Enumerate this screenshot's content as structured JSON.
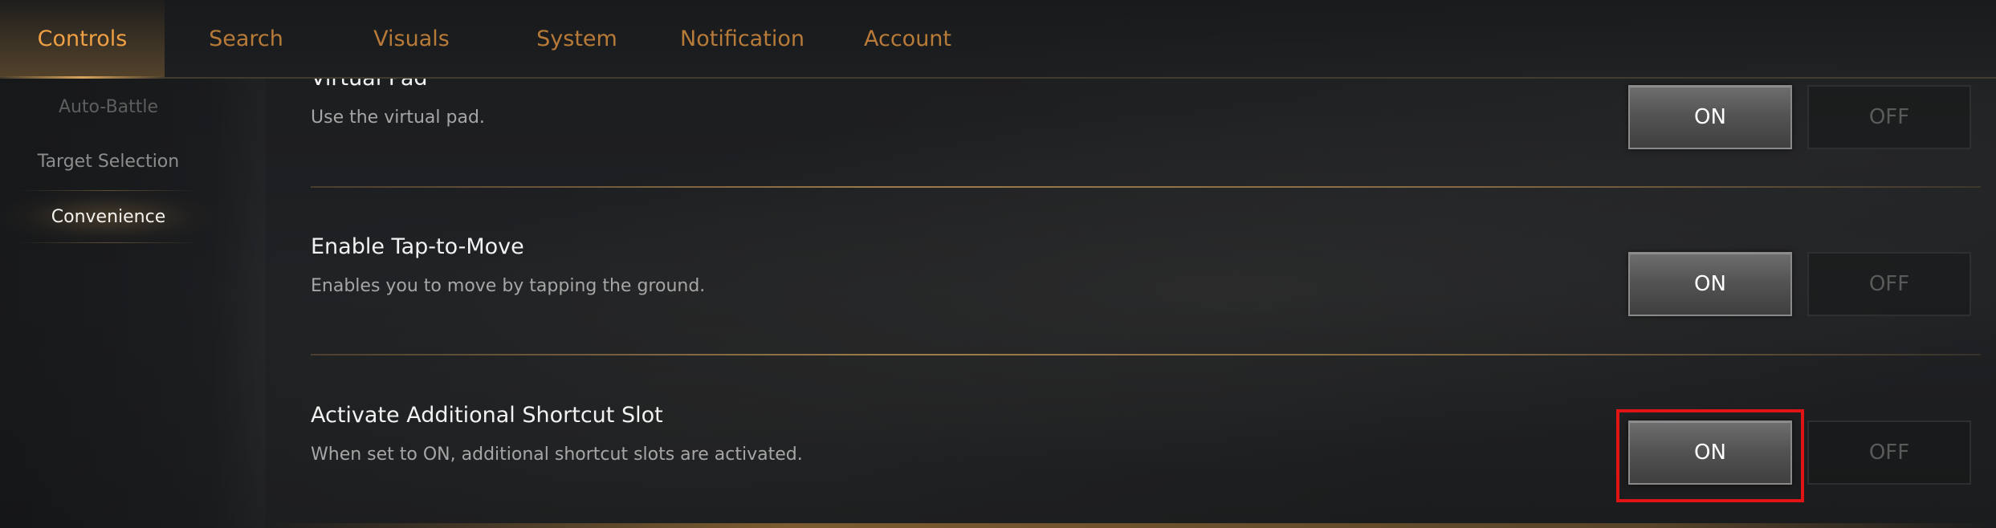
{
  "tabs": [
    {
      "label": "Controls",
      "active": true
    },
    {
      "label": "Search",
      "active": false
    },
    {
      "label": "Visuals",
      "active": false
    },
    {
      "label": "System",
      "active": false
    },
    {
      "label": "Notification",
      "active": false
    },
    {
      "label": "Account",
      "active": false
    }
  ],
  "sidebar": {
    "items": [
      {
        "label": "Auto-Battle",
        "active": false
      },
      {
        "label": "Target Selection",
        "active": false
      },
      {
        "label": "Convenience",
        "active": true
      }
    ]
  },
  "settings": [
    {
      "title": "Virtual Pad",
      "description": "Use the virtual pad.",
      "on_label": "ON",
      "off_label": "OFF",
      "value": "ON"
    },
    {
      "title": "Enable Tap-to-Move",
      "description": "Enables you to move by tapping the ground.",
      "on_label": "ON",
      "off_label": "OFF",
      "value": "ON"
    },
    {
      "title": "Activate Additional Shortcut Slot",
      "description": "When set to ON, additional shortcut slots are activated.",
      "on_label": "ON",
      "off_label": "OFF",
      "value": "ON",
      "highlighted": true
    }
  ],
  "colors": {
    "accent": "#f0a044",
    "tab_inactive": "#b87a38",
    "highlight": "#e01414"
  }
}
